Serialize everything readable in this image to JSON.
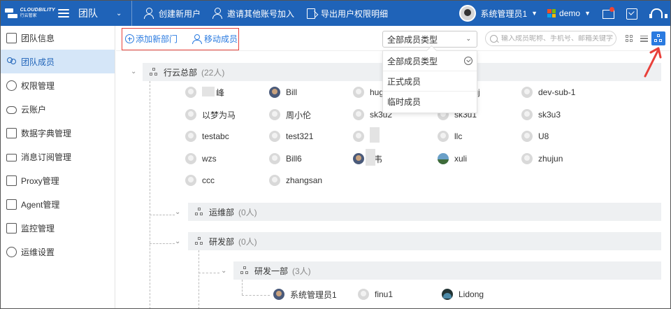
{
  "topbar": {
    "team_title": "团队",
    "actions": [
      "创建新用户",
      "邀请其他账号加入",
      "导出用户权限明细"
    ],
    "admin_name": "系统管理员1",
    "tenant": "demo",
    "brand_color": "#1f63b8",
    "logo_text": "CLOUDBILITY",
    "logo_sub": "行云管家"
  },
  "sidebar": {
    "items": [
      {
        "label": "团队信息",
        "icon": "doc-icon"
      },
      {
        "label": "团队成员",
        "icon": "people-icon",
        "active": true
      },
      {
        "label": "权限管理",
        "icon": "user-gear-icon"
      },
      {
        "label": "云账户",
        "icon": "cloud-icon"
      },
      {
        "label": "数据字典管理",
        "icon": "dictionary-icon"
      },
      {
        "label": "消息订阅管理",
        "icon": "mail-icon"
      },
      {
        "label": "Proxy管理",
        "icon": "proxy-icon"
      },
      {
        "label": "Agent管理",
        "icon": "agent-icon"
      },
      {
        "label": "监控管理",
        "icon": "monitor-icon"
      },
      {
        "label": "运维设置",
        "icon": "shield-gear-icon"
      }
    ]
  },
  "toolbar": {
    "add_department": "添加新部门",
    "move_member": "移动成员",
    "member_type_select": "全部成员类型",
    "search_placeholder": "输入成员昵称、手机号、邮箱关键字"
  },
  "dropdown": {
    "options": [
      "全部成员类型",
      "正式成员",
      "临时成员"
    ],
    "selected": "全部成员类型"
  },
  "tree": {
    "root": {
      "name": "行云总部",
      "count": "(22人)"
    },
    "root_members": [
      [
        "峰",
        "Bill",
        "hug",
        "1-tongj",
        "dev-sub-1"
      ],
      [
        "以梦为马",
        "周小伦",
        "sk3u2",
        "sk3u1",
        "sk3u3"
      ],
      [
        "testabc",
        "test321",
        "",
        "llc",
        "U8"
      ],
      [
        "wzs",
        "Bill6",
        "韦",
        "xuli",
        "zhujun"
      ],
      [
        "ccc",
        "zhangsan"
      ]
    ],
    "sub_departments": [
      {
        "name": "运维部",
        "count": "(0人)"
      },
      {
        "name": "研发部",
        "count": "(0人)"
      }
    ],
    "sub_sub_department": {
      "name": "研发一部",
      "count": "(3人)"
    },
    "sub_sub_members": [
      "系统管理员1",
      "finu1",
      "Lidong"
    ]
  }
}
